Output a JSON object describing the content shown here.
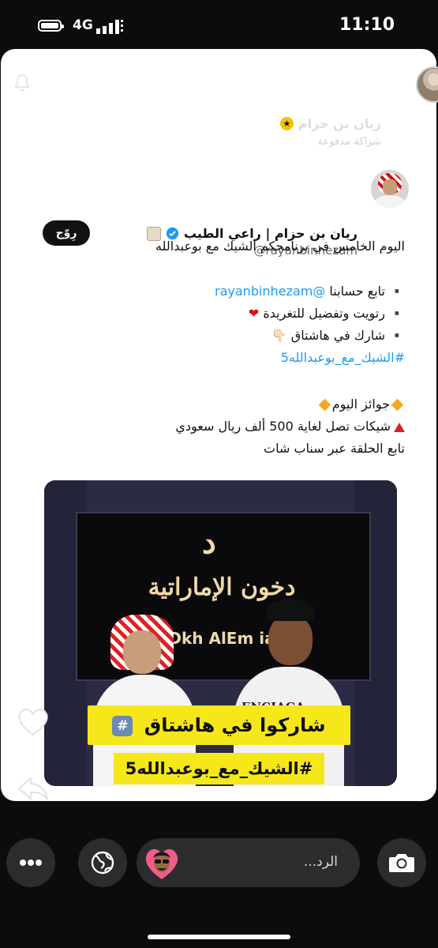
{
  "status_bar": {
    "network": "4G",
    "time": "11:10"
  },
  "chat": {
    "sender_name": "ريان بن حزام",
    "sender_subtitle": "شراكة مدفوعة"
  },
  "tweet": {
    "display_name": "ريان بن حزام | راعي الطيب",
    "handle": "@rayanbinhezam",
    "follow_label": "رِوّج",
    "text_line1": "اليوم الخامس في برنامجكم الشيك مع بوعبدالله",
    "bullet1_prefix": "▪️ تابع حسابنا ",
    "bullet1_mention": "@rayanbinhezam",
    "bullet2": "▪️ رتويت وتفضيل للتغريدة",
    "bullet3": "▪️ شارك في هاشتاق 👇🏻",
    "hashtag": "#الشيك_مع_بوعبدالله5",
    "prizes_title": "جوائز اليوم",
    "prizes_detail": "شيكات تصل لغاية 500 ألف ريال سعودي",
    "snap_line": "تابع الحلقة عبر سناب شات"
  },
  "media": {
    "logo_mark": "د",
    "logo_arabic": "دخون الإماراتية",
    "logo_latin": "Dkh  AlEm  ia",
    "shirt_text": "ENCIAGA",
    "banner_top": "شاركوا في هاشتاق",
    "banner_key": "#",
    "banner_bottom": "#الشيك_مع_بوعبدالله5"
  },
  "composer": {
    "reply_placeholder": "الرد..."
  },
  "colors": {
    "link_blue": "#1d9bf0",
    "banner_yellow": "#f6e71a",
    "heart_red": "#d11111"
  },
  "icons": [
    "battery-icon",
    "signal-icon",
    "bell-icon",
    "verified-icon",
    "heart-icon",
    "share-icon",
    "more-icon",
    "globe-icon",
    "camera-icon"
  ]
}
